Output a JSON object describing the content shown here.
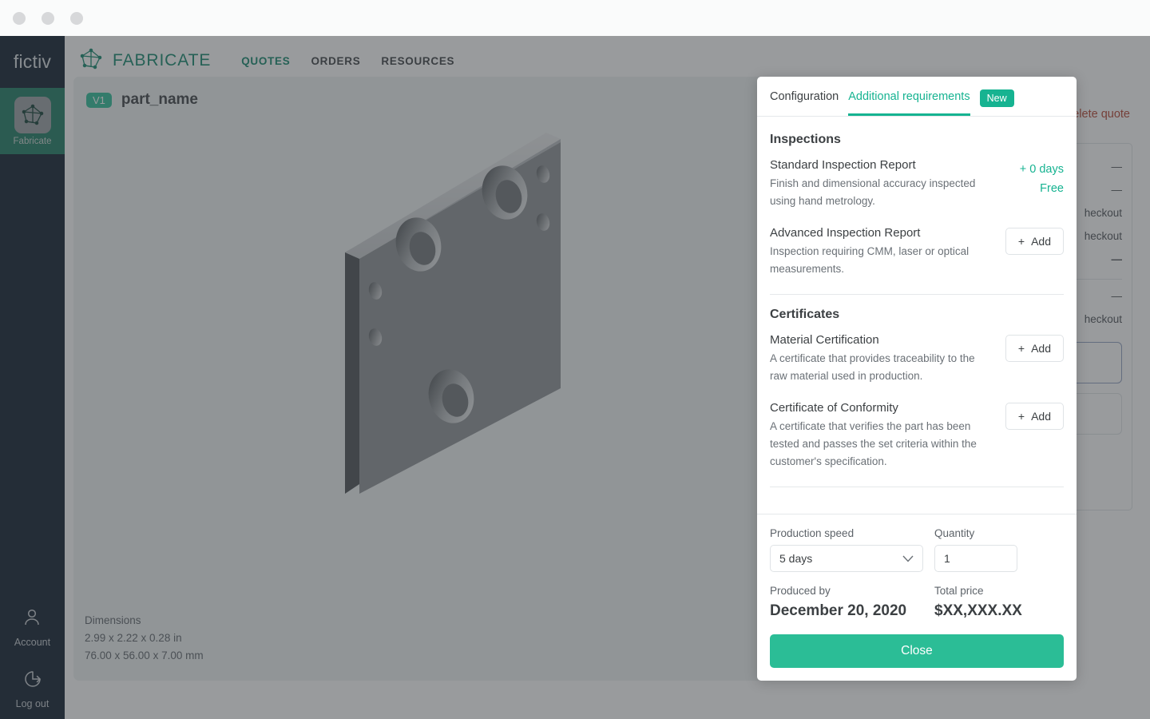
{
  "window": {
    "dots": [
      "close-dot",
      "minimize-dot",
      "maximize-dot"
    ]
  },
  "rail": {
    "logo": "fictiv",
    "active_item": {
      "label": "Fabricate",
      "icon": "fabricate-icon"
    },
    "bottom_items": [
      {
        "label": "Account",
        "icon": "user-icon"
      },
      {
        "label": "Log out",
        "icon": "logout-icon"
      }
    ]
  },
  "topnav": {
    "brand": "FABRICATE",
    "brand_icon": "fabricate-icon",
    "links": [
      {
        "label": "QUOTES",
        "active": true
      },
      {
        "label": "ORDERS",
        "active": false
      },
      {
        "label": "RESOURCES",
        "active": false
      }
    ]
  },
  "page_behind": {
    "delete_quote": "Delete quote",
    "summary_rows": [
      "—",
      "—",
      "heckout",
      "heckout",
      "—",
      "—",
      "heckout"
    ]
  },
  "part": {
    "version_badge": "V1",
    "name": "part_name",
    "dimensions_label": "Dimensions",
    "dimensions_in": "2.99 x 2.22 x 0.28 in",
    "dimensions_mm": "76.00 x 56.00 x 7.00 mm"
  },
  "modal": {
    "tabs": [
      {
        "label": "Configuration",
        "active": false
      },
      {
        "label": "Additional requirements",
        "active": true
      }
    ],
    "new_badge": "New",
    "sections": [
      {
        "title": "Inspections",
        "options": [
          {
            "name": "Standard Inspection Report",
            "desc": "Finish and dimensional accuracy inspected using hand metrology.",
            "days": "+ 0 days",
            "price": "Free",
            "action": null
          },
          {
            "name": "Advanced Inspection Report",
            "desc": "Inspection requiring CMM, laser or optical measurements.",
            "days": null,
            "price": null,
            "action": "Add"
          }
        ]
      },
      {
        "title": "Certificates",
        "options": [
          {
            "name": "Material Certification",
            "desc": "A certificate that provides traceability to the raw material used in production.",
            "days": null,
            "price": null,
            "action": "Add"
          },
          {
            "name": "Certificate of Conformity",
            "desc": "A certificate that verifies the part has been tested and passes the set criteria within the customer's specification.",
            "days": null,
            "price": null,
            "action": "Add"
          }
        ]
      }
    ],
    "footer": {
      "production_speed_label": "Production speed",
      "production_speed_value": "5 days",
      "quantity_label": "Quantity",
      "quantity_value": "1",
      "produced_by_label": "Produced by",
      "produced_by_value": "December 20, 2020",
      "total_price_label": "Total price",
      "total_price_value": "$XX,XXX.XX",
      "close_label": "Close"
    }
  },
  "colors": {
    "accent_teal": "#16b391",
    "button_teal": "#2bbd96",
    "brand_green": "#10866b",
    "rail_dark": "#0b1b2b",
    "rail_active": "#1a7a61",
    "danger_red": "#b5412f",
    "card_bg": "#eef2f3"
  }
}
